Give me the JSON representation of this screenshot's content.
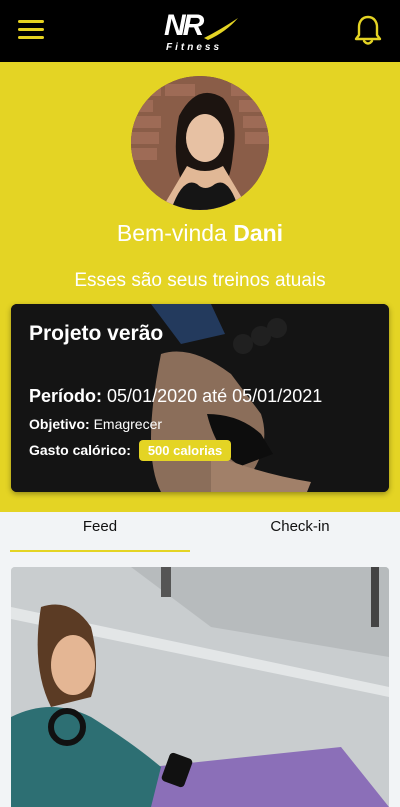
{
  "header": {
    "menu_icon": "hamburger-menu-icon",
    "logo_text": "NR",
    "logo_sub": "Fitness",
    "bell_icon": "bell-icon",
    "accent": "#e4d424"
  },
  "profile": {
    "greeting_prefix": "Bem-vinda",
    "name": "Dani",
    "subtitle": "Esses são seus treinos atuais"
  },
  "workout_card": {
    "title": "Projeto verão",
    "period_label": "Período:",
    "period_value": "05/01/2020 até 05/01/2021",
    "objective_label": "Objetivo:",
    "objective_value": "Emagrecer",
    "calories_label": "Gasto calórico:",
    "calories_value": "500 calorias"
  },
  "tabs": [
    {
      "label": "Feed",
      "active": true
    },
    {
      "label": "Check-in",
      "active": false
    }
  ]
}
